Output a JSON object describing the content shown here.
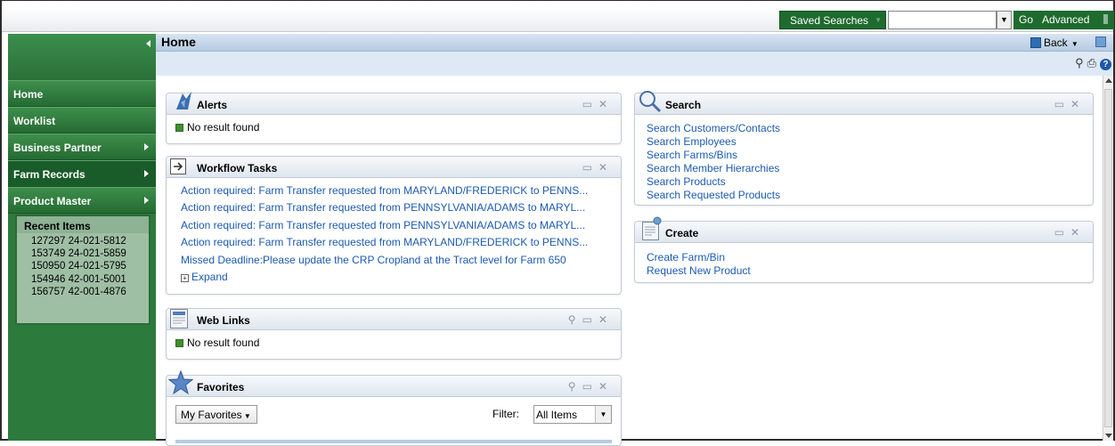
{
  "topbar": {
    "saved_searches": "Saved Searches",
    "search_value": "",
    "go": "Go",
    "advanced": "Advanced"
  },
  "sidebar": {
    "nav": [
      {
        "label": "Home",
        "has_submenu": false
      },
      {
        "label": "Worklist",
        "has_submenu": false
      },
      {
        "label": "Business Partner",
        "has_submenu": true
      },
      {
        "label": "Farm Records",
        "has_submenu": true
      },
      {
        "label": "Product Master",
        "has_submenu": true
      }
    ],
    "recent_title": "Recent Items",
    "recent_items": [
      "127297 24-021-5812",
      "153749 24-021-5859",
      "150950 24-021-5795",
      "154946 42-001-5001",
      "156757 42-001-4876"
    ]
  },
  "header": {
    "title": "Home",
    "back": "Back"
  },
  "alerts": {
    "title": "Alerts",
    "empty": "No result found"
  },
  "workflow": {
    "title": "Workflow Tasks",
    "tasks": [
      "Action required: Farm Transfer requested from MARYLAND/FREDERICK to PENNS...",
      "Action required: Farm Transfer requested from PENNSYLVANIA/ADAMS to MARYL...",
      "Action required: Farm Transfer requested from PENNSYLVANIA/ADAMS to MARYL...",
      "Action required: Farm Transfer requested from MARYLAND/FREDERICK to PENNS...",
      "Missed Deadline:Please update the CRP Cropland at the Tract level for Farm 650"
    ],
    "expand": "Expand"
  },
  "weblinks": {
    "title": "Web Links",
    "empty": "No result found"
  },
  "favorites": {
    "title": "Favorites",
    "select": "My Favorites",
    "filter_label": "Filter:",
    "filter_value": "All Items"
  },
  "search": {
    "title": "Search",
    "links": [
      "Search Customers/Contacts",
      "Search Employees",
      "Search Farms/Bins",
      "Search Member Hierarchies",
      "Search Products",
      "Search Requested Products"
    ]
  },
  "create": {
    "title": "Create",
    "links": [
      "Create Farm/Bin",
      "Request New Product"
    ]
  },
  "colors": {
    "sidebar_green": "#2d7a3d",
    "header_blue": "#b6cbe2",
    "link_blue": "#1c5ab0"
  }
}
